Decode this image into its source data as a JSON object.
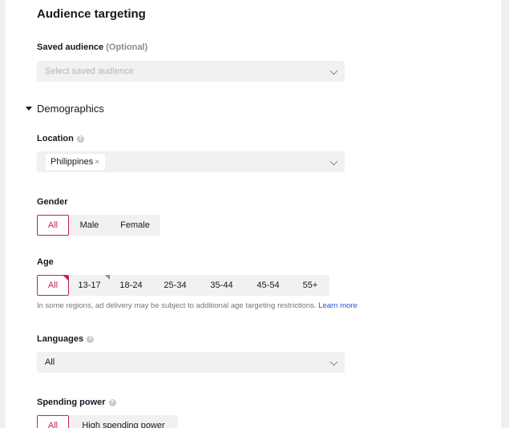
{
  "section": {
    "title": "Audience targeting"
  },
  "saved_audience": {
    "label": "Saved audience",
    "optional": "(Optional)",
    "placeholder": "Select saved audience"
  },
  "demographics": {
    "title": "Demographics"
  },
  "location": {
    "label": "Location",
    "selected": [
      {
        "value": "Philippines",
        "remove": "×"
      }
    ]
  },
  "gender": {
    "label": "Gender",
    "options": [
      "All",
      "Male",
      "Female"
    ],
    "selected": "All"
  },
  "age": {
    "label": "Age",
    "options": [
      "All",
      "13-17",
      "18-24",
      "25-34",
      "35-44",
      "45-54",
      "55+"
    ],
    "selected": "All",
    "note": "In some regions, ad delivery may be subject to additional age targeting restrictions.",
    "learn_more": "Learn more"
  },
  "languages": {
    "label": "Languages",
    "value": "All"
  },
  "spending_power": {
    "label": "Spending power",
    "options": [
      "All",
      "High spending power"
    ],
    "selected": "All"
  },
  "colors": {
    "accent": "#c4235b",
    "link": "#2352d8",
    "field_bg": "#f1f1f2"
  },
  "icons": {
    "help": "question-circle-icon",
    "dropdown": "chevron-down-icon",
    "collapse": "caret-down-icon"
  }
}
